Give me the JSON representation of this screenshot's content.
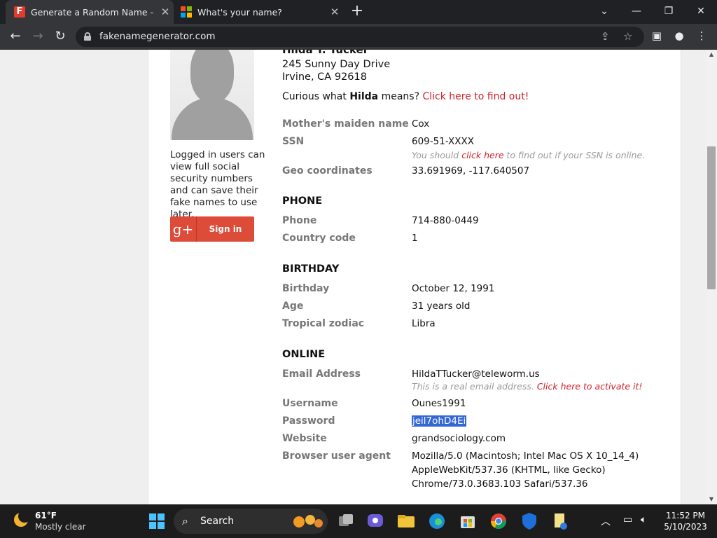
{
  "browser": {
    "tabs": [
      {
        "title": "Generate a Random Name - Fake"
      },
      {
        "title": "What's your name?"
      }
    ],
    "url": "fakenamegenerator.com"
  },
  "sidebar": {
    "login_note": "Logged in users can view full social security numbers and can save their fake names to use later.",
    "signin_glyph": "g+",
    "signin_label": "Sign in"
  },
  "person": {
    "name": "Hilda T. Tucker",
    "address_line1": "245 Sunny Day Drive",
    "address_line2": "Irvine, CA 92618",
    "curious_prefix": "Curious what ",
    "curious_name": "Hilda",
    "curious_suffix": " means? ",
    "curious_link": "Click here to find out!",
    "rows": {
      "maiden_label": "Mother's maiden name",
      "maiden_value": "Cox",
      "ssn_label": "SSN",
      "ssn_value": "609-51-XXXX",
      "ssn_note_prefix": "You should ",
      "ssn_note_link": "click here",
      "ssn_note_suffix": " to find out if your SSN is online.",
      "geo_label": "Geo coordinates",
      "geo_value": "33.691969, -117.640507"
    }
  },
  "phone": {
    "heading": "PHONE",
    "phone_label": "Phone",
    "phone_value": "714-880-0449",
    "country_label": "Country code",
    "country_value": "1"
  },
  "birthday": {
    "heading": "BIRTHDAY",
    "birthday_label": "Birthday",
    "birthday_value": "October 12, 1991",
    "age_label": "Age",
    "age_value": "31 years old",
    "zodiac_label": "Tropical zodiac",
    "zodiac_value": "Libra"
  },
  "online": {
    "heading": "ONLINE",
    "email_label": "Email Address",
    "email_value": "HildaTTucker@teleworm.us",
    "email_note_prefix": "This is a real email address. ",
    "email_note_link": "Click here to activate it!",
    "username_label": "Username",
    "username_value": "Ounes1991",
    "password_label": "Password",
    "password_value": "jeil7ohD4Ei",
    "website_label": "Website",
    "website_value": "grandsociology.com",
    "ua_label": "Browser user agent",
    "ua_line1": "Mozilla/5.0 (Macintosh; Intel Mac OS X 10_14_4)",
    "ua_line2": "AppleWebKit/537.36 (KHTML, like Gecko)",
    "ua_line3": "Chrome/73.0.3683.103 Safari/537.36"
  },
  "taskbar": {
    "temperature": "61°F",
    "condition": "Mostly clear",
    "search_label": "Search",
    "time": "11:52 PM",
    "date": "5/10/2023"
  },
  "colors": {
    "accent_red": "#d0212b",
    "selection": "#3367d6",
    "google_red": "#dd4b39"
  }
}
